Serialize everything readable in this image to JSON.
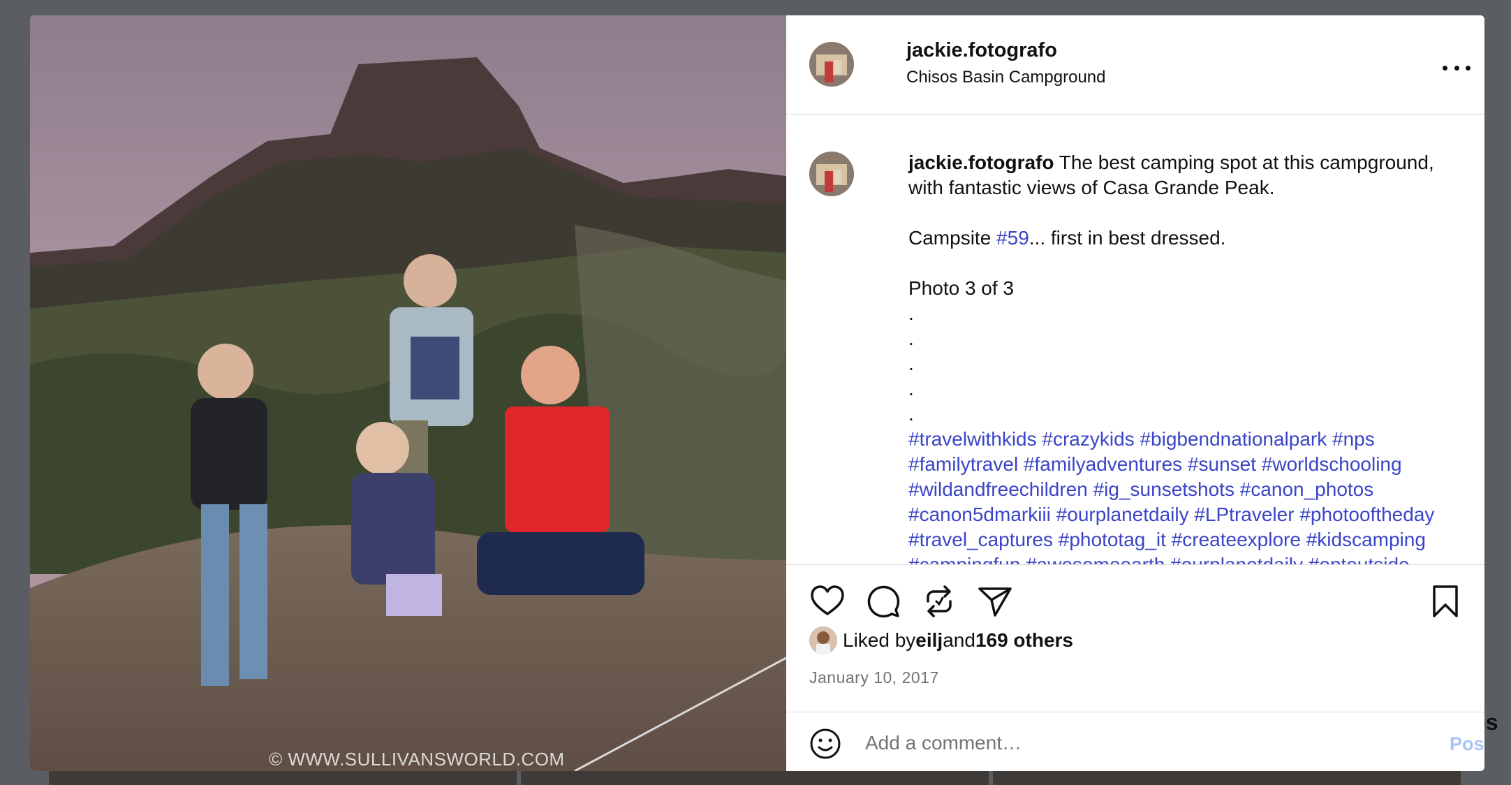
{
  "post": {
    "username": "jackie.fotografo",
    "location": "Chisos Basin Campground",
    "photo_watermark": "© WWW.SULLIVANSWORLD.COM"
  },
  "caption": {
    "username": "jackie.fotografo",
    "line1": " The best camping spot at this campground, with fantastic views of Casa Grande Peak.",
    "line2_pre": "Campsite ",
    "line2_tag": "#59",
    "line2_post": "... first in best dressed.",
    "line3": "Photo 3 of 3",
    "dots": [
      ".",
      ".",
      ".",
      ".",
      "."
    ],
    "hashtags_line1": "#travelwithkids #crazykids #bigbendnationalpark #nps",
    "hashtags_line2": "#familytravel #familyadventures #sunset #worldschooling",
    "hashtags_line3": "#wildandfreechildren #ig_sunsetshots #canon_photos",
    "hashtags_line4": "#canon5dmarkiii #ourplanetdaily #LPtraveler #photooftheday",
    "hashtags_line5": "#travel_captures #phototag_it #createexplore #kidscamping",
    "hashtags_line6": "#campingfun #awesomeearth #ourplanetdaily #optoutside"
  },
  "icons": {
    "more": "more-horizontal-icon",
    "like": "heart-icon",
    "comment": "comment-icon",
    "repost": "repost-icon",
    "share": "send-icon",
    "save": "bookmark-icon",
    "emoji": "emoji-icon"
  },
  "likes": {
    "prefix": "Liked by ",
    "user": "eilj",
    "middle": " and ",
    "others": "169 others"
  },
  "date": "January 10, 2017",
  "comment": {
    "placeholder": "Add a comment…",
    "post_label": "Post"
  },
  "background_text": "es",
  "colors": {
    "backdrop": "#5a5d61",
    "hashtag": "#3a44c7",
    "post_button_disabled": "#a8c5f5",
    "muted": "#737373"
  }
}
